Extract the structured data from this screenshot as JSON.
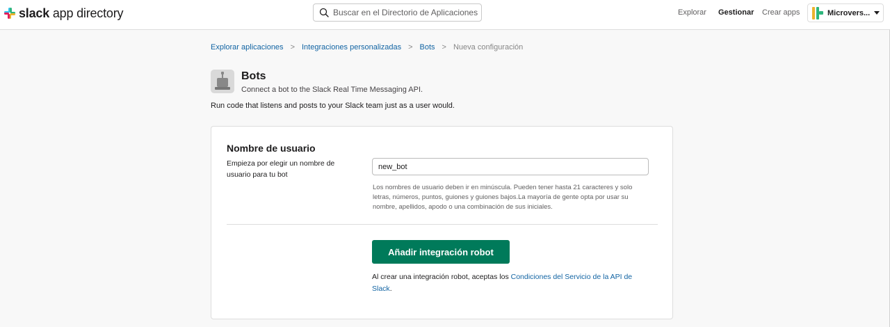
{
  "header": {
    "logo_bold": "slack",
    "logo_rest": " app directory",
    "search_placeholder": "Buscar en el Directorio de Aplicaciones",
    "nav": [
      "Explorar",
      "Gestionar",
      "Crear apps"
    ],
    "workspace_name": "Microvers...",
    "colors": {
      "brand_green": "#007a5a",
      "link": "#1264a3"
    }
  },
  "breadcrumb": {
    "items": [
      "Explorar aplicaciones",
      "Integraciones personalizadas",
      "Bots"
    ],
    "current": "Nueva configuración",
    "separator": ">"
  },
  "app": {
    "icon": "robot-icon",
    "title": "Bots",
    "subtitle": "Connect a bot to the Slack Real Time Messaging API.",
    "description": "Run code that listens and posts to your Slack team just as a user would."
  },
  "form": {
    "field_title": "Nombre de usuario",
    "field_help": "Empieza por elegir un nombre de usuario para tu bot",
    "input_value": "new_bot",
    "input_hint": "Los nombres de usuario deben ir en minúscula. Pueden tener hasta 21 caracteres y solo letras, números, puntos, guiones y guiones bajos.La mayoría de gente opta por usar su nombre, apellidos, apodo o una combinación de sus iniciales.",
    "submit_label": "Añadir integración robot",
    "terms_prefix": "Al crear una integración robot, aceptas los ",
    "terms_link": "Condiciones del Servicio de la API de Slack",
    "terms_suffix": "."
  }
}
